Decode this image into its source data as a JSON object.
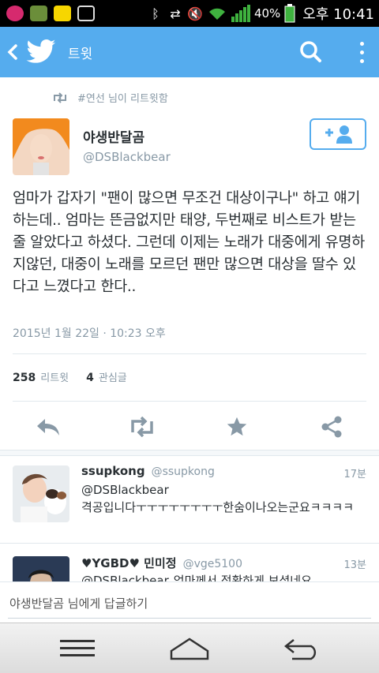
{
  "status_bar": {
    "battery": "40%",
    "time": "오후 10:41"
  },
  "app_bar": {
    "title": "트윗",
    "icons": [
      "back-arrow-icon",
      "twitter-bird-icon",
      "search-icon",
      "more-vert-icon"
    ]
  },
  "tweet": {
    "retweeted_by": "#연선 님이 리트윗함",
    "name": "야생반달곰",
    "handle": "@DSBlackbear",
    "text": "엄마가 갑자기 \"팬이 많으면 무조건 대상이구나\" 하고 얘기하는데.. 엄마는 뜬금없지만 태양, 두번째로 비스트가 받는줄 알았다고 하셨다. 그런데 이제는 노래가 대중에게 유명하지않던, 대중이 노래를 모르던 팬만 많으면 대상을 딸수 있다고 느꼈다고 한다..",
    "timestamp": "2015년 1월 22일 · 10:23 오후",
    "retweet_count": "258",
    "retweet_label": "리트윗",
    "favorite_count": "4",
    "favorite_label": "관심글",
    "accent_color": "#55acee"
  },
  "replies": [
    {
      "name": "ssupkong",
      "handle": "@ssupkong",
      "time": "17분",
      "mention": "@DSBlackbear",
      "text": "격공입니다ㅜㅜㅜㅜㅜㅜㅜㅜ한숨이나오는군요ㅋㅋㅋㅋ"
    },
    {
      "name": "♥YGBD♥ 민미정",
      "handle": "@vge5100",
      "time": "13분",
      "mention": "@DSBlackbear",
      "text": "엄마께서 정확하게 보셨네요"
    }
  ],
  "compose": {
    "placeholder": "야생반달곰 님에게 답글하기"
  },
  "nav": {
    "icons": [
      "menu-icon",
      "home-icon",
      "back-icon"
    ]
  }
}
